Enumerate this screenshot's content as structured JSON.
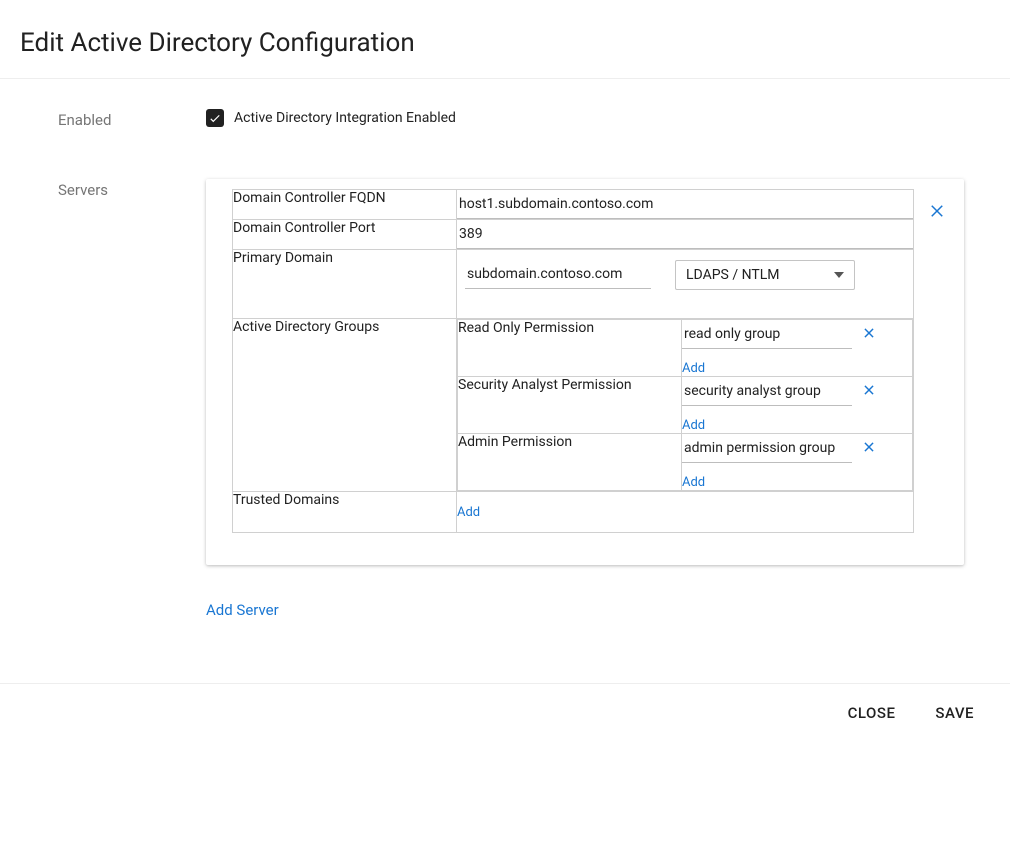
{
  "header": {
    "title": "Edit Active Directory Configuration"
  },
  "enabled": {
    "section_label": "Enabled",
    "checkbox_label": "Active Directory Integration Enabled",
    "checked": true
  },
  "servers": {
    "section_label": "Servers",
    "add_server": "Add Server",
    "labels": {
      "fqdn": "Domain Controller FQDN",
      "port": "Domain Controller Port",
      "primary_domain": "Primary Domain",
      "ad_groups": "Active Directory Groups",
      "trusted_domains": "Trusted Domains",
      "add": "Add"
    },
    "items": [
      {
        "fqdn": "host1.subdomain.contoso.com",
        "port": "389",
        "primary_domain": "subdomain.contoso.com",
        "auth_method": "LDAPS / NTLM",
        "groups": [
          {
            "permission_label": "Read Only Permission",
            "group_value": "read only group"
          },
          {
            "permission_label": "Security Analyst Permission",
            "group_value": "security analyst group"
          },
          {
            "permission_label": "Admin Permission",
            "group_value": "admin permission group"
          }
        ]
      }
    ]
  },
  "footer": {
    "close": "CLOSE",
    "save": "SAVE"
  }
}
